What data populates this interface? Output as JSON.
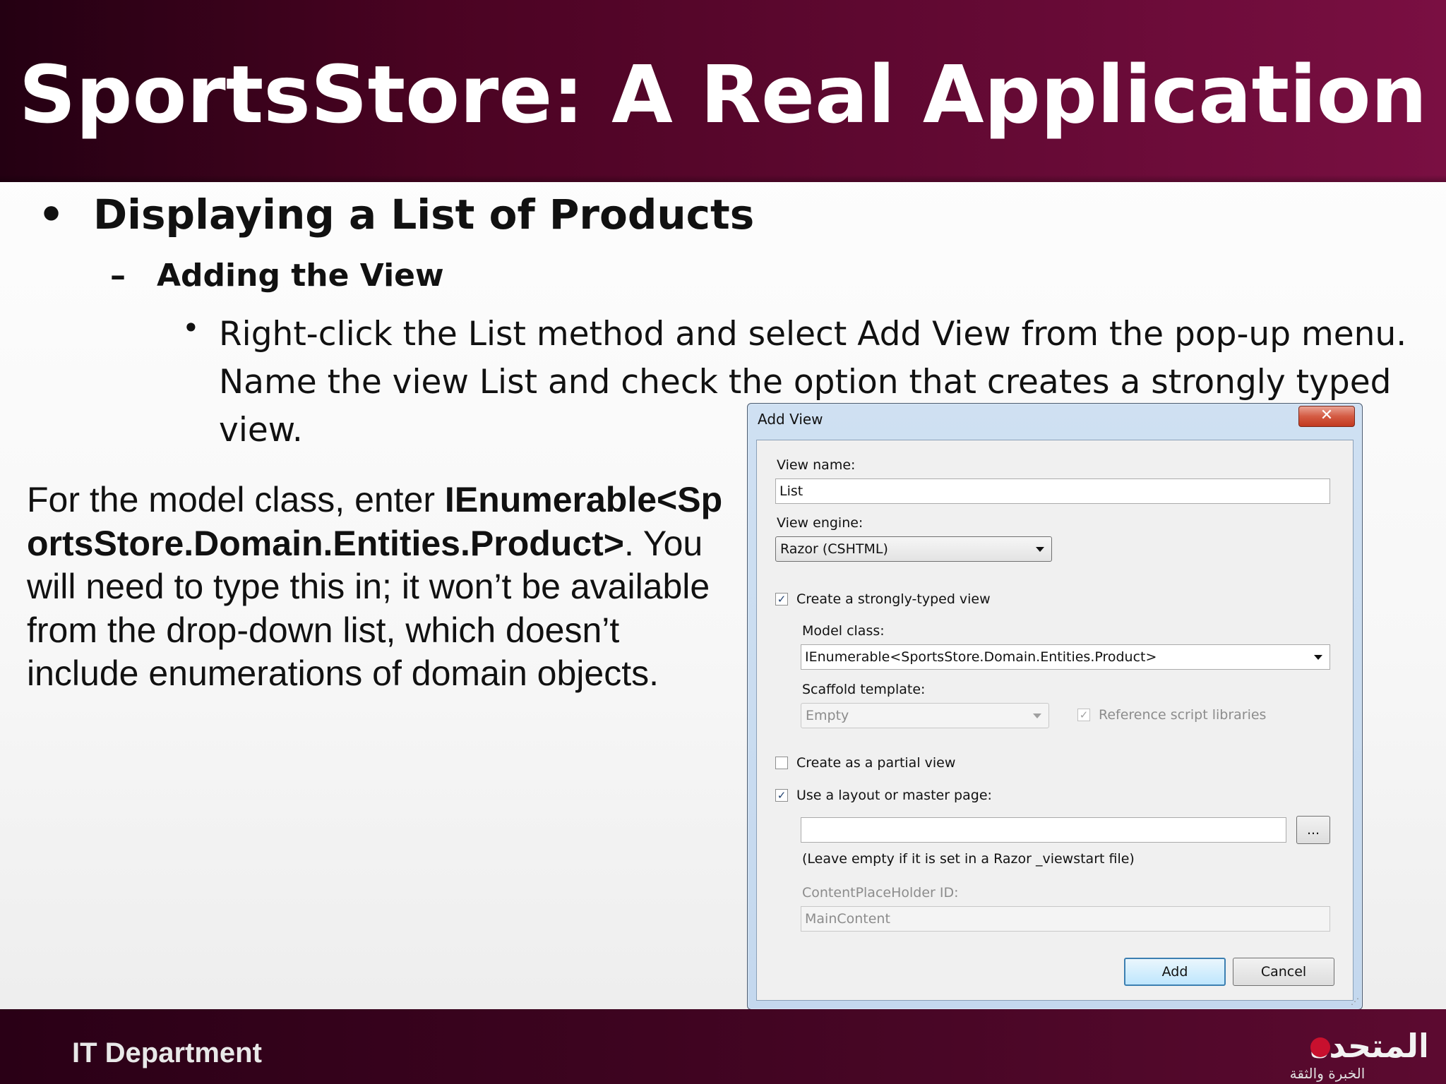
{
  "slide": {
    "title": "SportsStore: A Real Application",
    "bullet_l1": "Displaying a List of Products",
    "bullet_l2": "Adding the View",
    "bullet_l3": "Right-click the List method and select Add View from the pop-up menu. Name the view List and check the option that creates a strongly typed view.",
    "note_prefix": "For the model class, enter ",
    "note_bold": "IEnumerable<SportsStore.Domain.Entities.Product>",
    "note_suffix": ". You will need to type this in; it won’t be available from the drop-down list, which doesn’t include enumerations of domain objects.",
    "bullet_glyph": "•",
    "dash_glyph": "–"
  },
  "footer": {
    "department": "IT Department",
    "logo_text": "المتحدة",
    "logo_subtext": "الخبرة والثقة"
  },
  "dialog": {
    "title": "Add View",
    "close_glyph": "✕",
    "view_name_label": "View name:",
    "view_name_value": "List",
    "view_engine_label": "View engine:",
    "view_engine_value": "Razor (CSHTML)",
    "strongly_typed_label": "Create a strongly-typed view",
    "strongly_typed_checked": true,
    "model_class_label": "Model class:",
    "model_class_value": "IEnumerable<SportsStore.Domain.Entities.Product>",
    "scaffold_label": "Scaffold template:",
    "scaffold_value": "Empty",
    "reference_scripts_label": "Reference script libraries",
    "reference_scripts_checked": true,
    "partial_view_label": "Create as a partial view",
    "partial_view_checked": false,
    "layout_label": "Use a layout or master page:",
    "layout_checked": true,
    "layout_value": "",
    "browse_label": "...",
    "layout_hint": "(Leave empty if it is set in a Razor _viewstart file)",
    "placeholder_id_label": "ContentPlaceHolder ID:",
    "placeholder_id_value": "MainContent",
    "add_label": "Add",
    "cancel_label": "Cancel",
    "check_glyph": "✓"
  }
}
